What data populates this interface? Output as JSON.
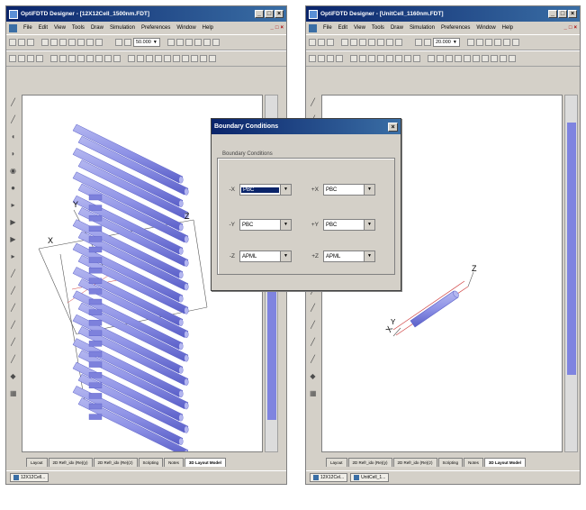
{
  "left_window": {
    "title": "OptiFDTD Designer - [12X12Cell_1500nm.FDT]",
    "menus": [
      "File",
      "Edit",
      "View",
      "Tools",
      "Draw",
      "Simulation",
      "Preferences",
      "Window",
      "Help"
    ],
    "zoom_value": "50.000",
    "axes": {
      "x": "X",
      "y": "Y",
      "z": "Z"
    },
    "tabs": [
      "Layout",
      "2D Refr_idx (Re)(y)",
      "2D Refr_idx (Re)(z)",
      "Scripting",
      "Notes",
      "3D Layout Model"
    ],
    "active_tab": "3D Layout Model",
    "taskbar": [
      "12X12Cell..."
    ]
  },
  "right_window": {
    "title": "OptiFDTD Designer - [UnitCell_1160nm.FDT]",
    "menus": [
      "File",
      "Edit",
      "View",
      "Tools",
      "Draw",
      "Simulation",
      "Preferences",
      "Window",
      "Help"
    ],
    "zoom_value": "20.000",
    "axes": {
      "x": "X",
      "y": "Y",
      "z": "Z"
    },
    "tabs": [
      "Layout",
      "2D Refr_idx (Re)(y)",
      "2D Refr_idx (Re)(z)",
      "Scripting",
      "Notes",
      "3D Layout Model"
    ],
    "active_tab": "3D Layout Model",
    "taskbar": [
      "12X12Cel...",
      "UnitCell_1..."
    ]
  },
  "dialog": {
    "title": "Boundary Conditions",
    "group_label": "Boundary Conditions",
    "rows": [
      {
        "neg_label": "-X",
        "neg_value": "PBC",
        "pos_label": "+X",
        "pos_value": "PBC"
      },
      {
        "neg_label": "-Y",
        "neg_value": "PBC",
        "pos_label": "+Y",
        "pos_value": "PBC"
      },
      {
        "neg_label": "-Z",
        "neg_value": "APML",
        "pos_label": "+Z",
        "pos_value": "APML"
      }
    ]
  },
  "colors": {
    "rod": "#8e92e6",
    "rod_dark": "#5a5fc8",
    "title_gradient_start": "#0a246a",
    "scroll_thumb": "#7f84e0"
  }
}
